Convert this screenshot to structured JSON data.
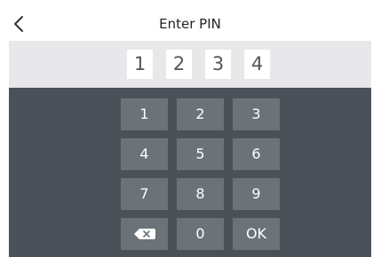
{
  "header": {
    "title": "Enter PIN",
    "back_icon": "chevron-left-icon"
  },
  "pin": {
    "digits": [
      "1",
      "2",
      "3",
      "4"
    ]
  },
  "keypad": {
    "keys": [
      "1",
      "2",
      "3",
      "4",
      "5",
      "6",
      "7",
      "8",
      "9"
    ],
    "zero": "0",
    "ok": "OK",
    "backspace_icon": "backspace-icon"
  },
  "colors": {
    "panel_bg": "#4a5158",
    "key_bg": "#6b7378",
    "pin_bar_bg": "#e8e8ea",
    "header_bg": "#ffffff"
  }
}
